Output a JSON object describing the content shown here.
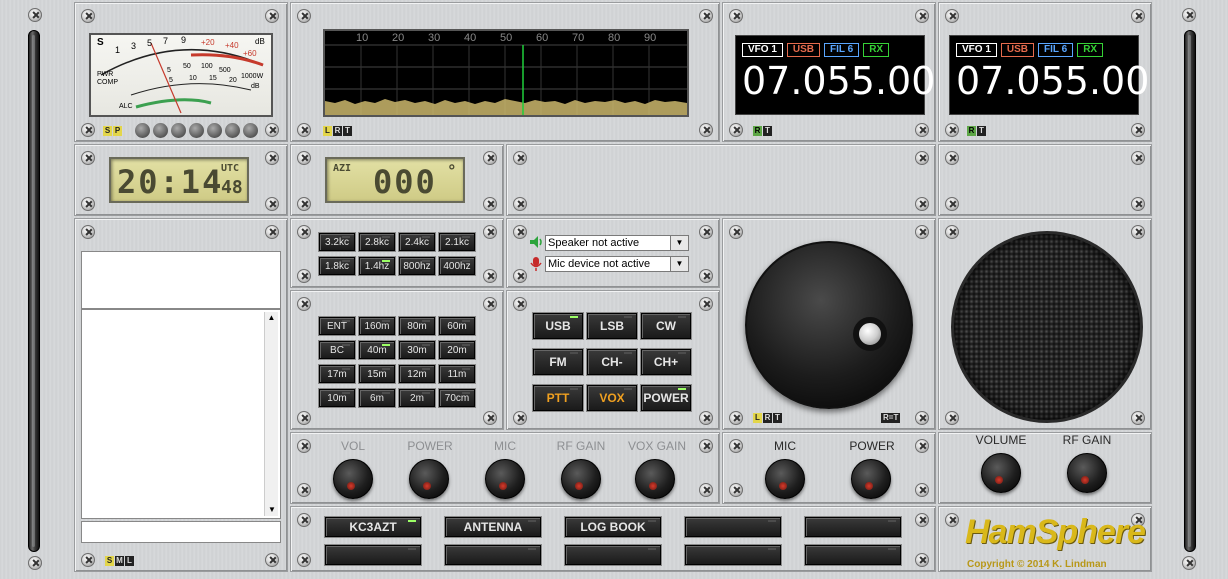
{
  "meter": {
    "s_scale": [
      "S",
      "1",
      "3",
      "5",
      "7",
      "9",
      "+20",
      "+40",
      "+60",
      "dB"
    ],
    "pwr_label": "PWR",
    "comp_label": "COMP",
    "alc_label": "ALC",
    "pwr_scale": [
      "5",
      "50",
      "100",
      "500",
      "1000W"
    ],
    "comp_scale": [
      "5",
      "10",
      "15",
      "20",
      "dB"
    ],
    "bottom_led_label": "S P"
  },
  "spectrum": {
    "ticks": [
      "10",
      "20",
      "30",
      "40",
      "50",
      "60",
      "70",
      "80",
      "90"
    ],
    "tag": [
      "L",
      "R",
      "T"
    ]
  },
  "vfo_a": {
    "tags": [
      "VFO 1",
      "USB",
      "FIL 6",
      "RX"
    ],
    "frequency": "07.055.00",
    "tag": [
      "R",
      "T"
    ]
  },
  "vfo_b": {
    "tags": [
      "VFO 1",
      "USB",
      "FIL 6",
      "RX"
    ],
    "frequency": "07.055.00",
    "tag": [
      "R",
      "T"
    ]
  },
  "clock": {
    "time": "20:14",
    "seconds": "48",
    "zone": "UTC"
  },
  "azimuth": {
    "label": "AZI",
    "value": "000",
    "unit": "°"
  },
  "filters": [
    "3.2kc",
    "2.8kc",
    "2.4kc",
    "2.1kc",
    "1.8kc",
    "1.4hz",
    "800hz",
    "400hz"
  ],
  "audio": {
    "speaker": "Speaker not active",
    "mic": "Mic device not active"
  },
  "bands": [
    "ENT",
    "160m",
    "80m",
    "60m",
    "BC",
    "40m",
    "30m",
    "20m",
    "17m",
    "15m",
    "12m",
    "11m",
    "10m",
    "6m",
    "2m",
    "70cm"
  ],
  "modes": [
    {
      "label": "USB",
      "led": true
    },
    {
      "label": "LSB",
      "led": false
    },
    {
      "label": "CW",
      "led": false
    },
    {
      "label": "FM",
      "led": false
    },
    {
      "label": "CH-",
      "led": false
    },
    {
      "label": "CH+",
      "led": false
    },
    {
      "label": "PTT",
      "led": false
    },
    {
      "label": "VOX",
      "led": false
    },
    {
      "label": "POWER",
      "led": true
    }
  ],
  "tuning": {
    "left_tag": [
      "L",
      "R",
      "T"
    ],
    "right_tag": "R=T"
  },
  "knobs_main": [
    "VOL",
    "POWER",
    "MIC",
    "RF GAIN",
    "VOX GAIN"
  ],
  "knobs_mid": [
    "MIC",
    "POWER"
  ],
  "knobs_right": [
    "VOLUME",
    "RF GAIN"
  ],
  "memory": [
    "KC3AZT",
    "ANTENNA",
    "LOG BOOK",
    "",
    ""
  ],
  "left_panel_tag": [
    "S",
    "M",
    "L"
  ],
  "brand": {
    "logo": "HamSphere",
    "copyright": "Copyright © 2014 K. Lindman"
  },
  "colors": {
    "accent_yellow": "#e3d64a",
    "led_green": "#9cff66",
    "vfo_usb": "#e66b4d",
    "vfo_fil": "#5aa6ff",
    "vfo_rx": "#36d236",
    "ptt_vox": "#f0a020",
    "brand": "#d9b81a"
  }
}
